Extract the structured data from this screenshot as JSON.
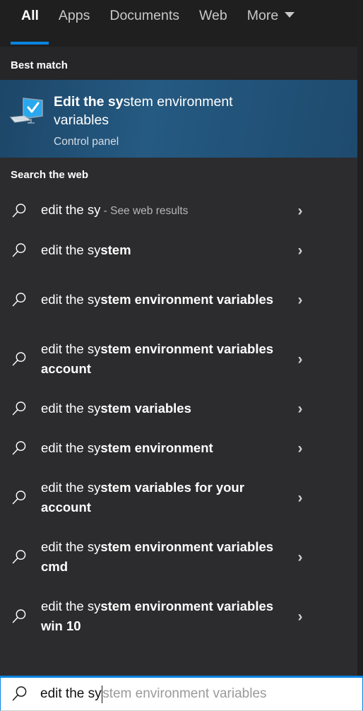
{
  "window": {
    "accent_blue": "#0a84e0",
    "panel_bg": "#2c2c2e",
    "header_bg": "#1f1f1f",
    "highlight_blue": "#235680"
  },
  "tabs": [
    {
      "label": "All",
      "active": true
    },
    {
      "label": "Apps",
      "active": false
    },
    {
      "label": "Documents",
      "active": false
    },
    {
      "label": "Web",
      "active": false
    },
    {
      "label": "More",
      "active": false,
      "caret": "chevron-down-icon"
    }
  ],
  "best_match": {
    "heading": "Best match",
    "icon": "system-properties-icon",
    "title_query": "Edit the sy",
    "title_rest": "stem environment variables",
    "subtitle": "Control panel"
  },
  "search_the_web": {
    "heading": "Search the web",
    "items": [
      {
        "query": "edit the sy",
        "rest": "",
        "note": " - See web results",
        "lines": 1
      },
      {
        "query": "edit the sy",
        "rest": "stem",
        "note": "",
        "lines": 1
      },
      {
        "query": "edit the sy",
        "rest": "stem environment variables",
        "note": "",
        "lines": 2
      },
      {
        "query": "edit the sy",
        "rest": "stem environment variables account",
        "note": "",
        "lines": 2
      },
      {
        "query": "edit the sy",
        "rest": "stem variables",
        "note": "",
        "lines": 1
      },
      {
        "query": "edit the sy",
        "rest": "stem environment",
        "note": "",
        "lines": 1
      },
      {
        "query": "edit the sy",
        "rest": "stem variables for your account",
        "note": "",
        "lines": 2
      },
      {
        "query": "edit the sy",
        "rest": "stem environment variables cmd",
        "note": "",
        "lines": 2
      },
      {
        "query": "edit the sy",
        "rest": "stem environment variables win 10",
        "note": "",
        "lines": 2
      }
    ],
    "chevron": "chevron-right-icon"
  },
  "search_input": {
    "icon": "search-icon",
    "typed_value": "edit the sy",
    "ghost_completion": "stem environment variables",
    "full_placeholder": "edit the system environment variables"
  }
}
